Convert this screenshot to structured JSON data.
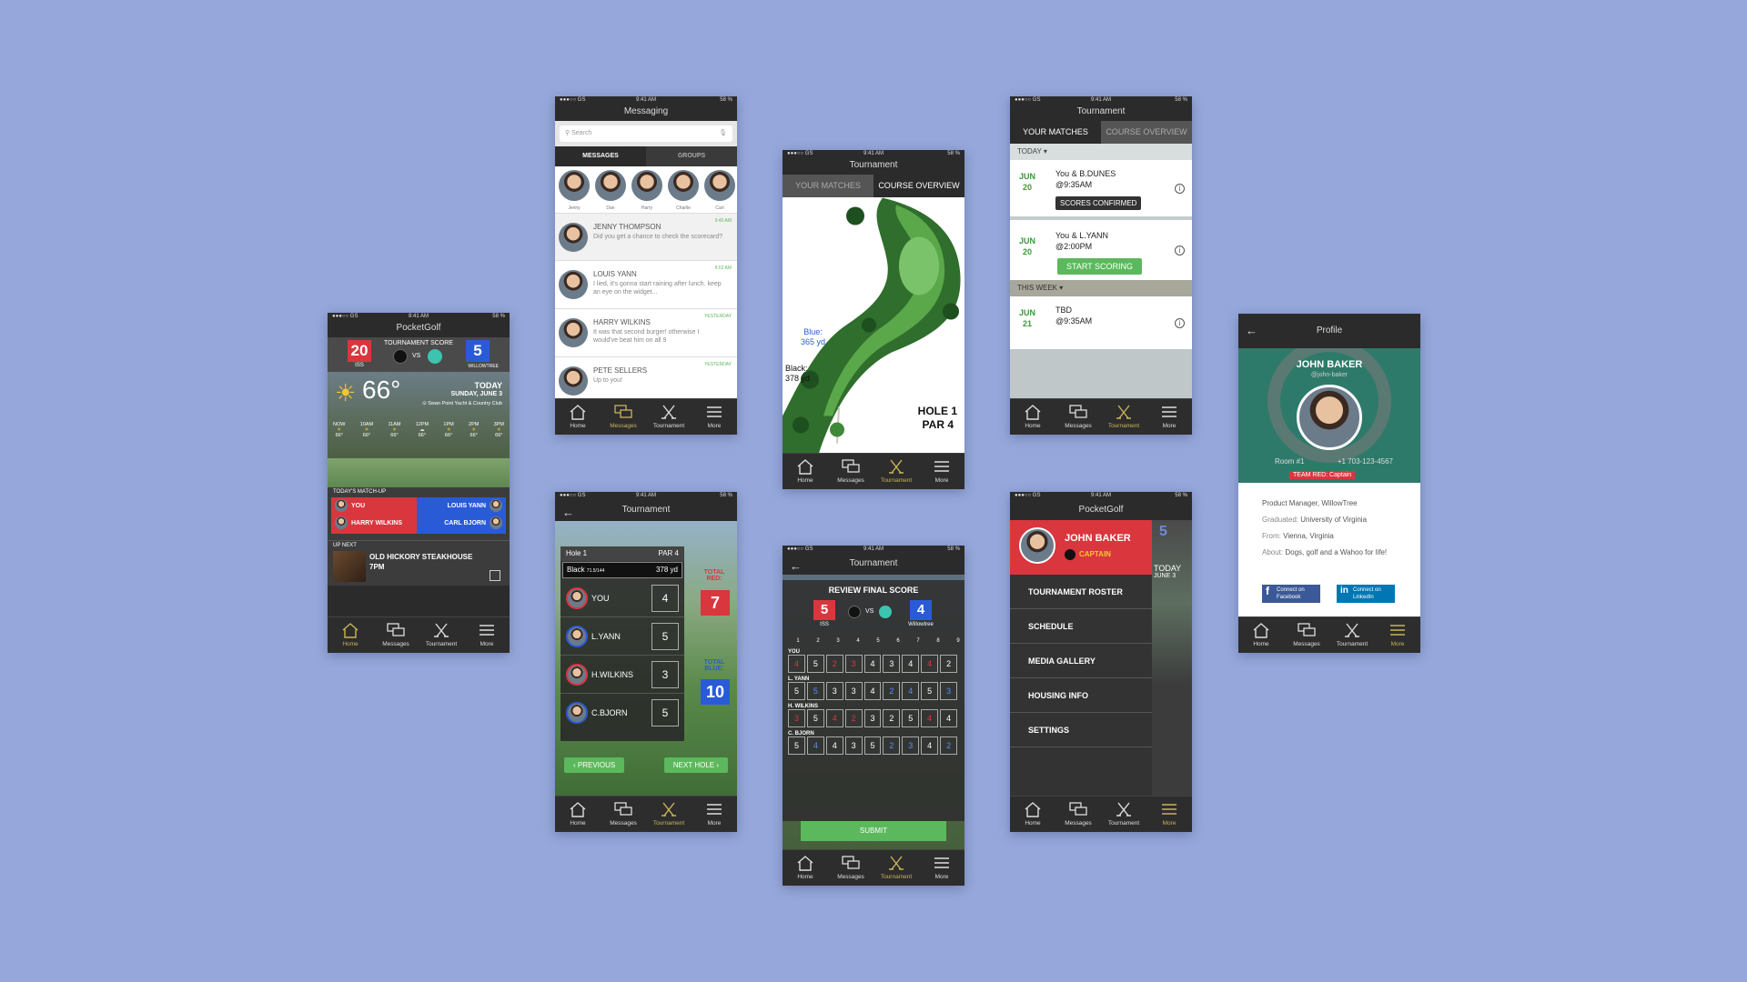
{
  "status": {
    "carrier": "●●●○○ GS",
    "time": "9:41 AM",
    "battery": "58 %"
  },
  "s1time": "8:41 AM",
  "tabs": [
    "Home",
    "Messages",
    "Tournament",
    "More"
  ],
  "colors": {
    "red": "#d9363e",
    "blue": "#2a5bd7",
    "gold": "#c9b458",
    "green": "#5cb85c"
  },
  "home": {
    "title": "PocketGolf",
    "tournament_label": "TOURNAMENT SCORE",
    "vs": "VS",
    "red_score": "20",
    "red_team": "ISS",
    "blue_score": "5",
    "blue_team": "WILLOWTREE",
    "temp": "66°",
    "today": "TODAY",
    "date": "SUNDAY, JUNE 3",
    "location": "Swan Point Yacht & Country Club",
    "forecast": [
      {
        "t": "NOW",
        "v": "66°"
      },
      {
        "t": "10AM",
        "v": "66°"
      },
      {
        "t": "11AM",
        "v": "66°"
      },
      {
        "t": "12PM",
        "v": "66°"
      },
      {
        "t": "1PM",
        "v": "66°"
      },
      {
        "t": "2PM",
        "v": "66°"
      },
      {
        "t": "3PM",
        "v": "66°"
      }
    ],
    "matchup_label": "TODAY'S MATCH-UP",
    "you": "YOU",
    "p2": "HARRY WILKINS",
    "p3": "LOUIS YANN",
    "p4": "CARL BJORN",
    "upnext_label": "UP NEXT",
    "event": "OLD HICKORY STEAKHOUSE",
    "event_time": "7PM"
  },
  "messaging": {
    "title": "Messaging",
    "search": "Search",
    "tab1": "MESSAGES",
    "tab2": "GROUPS",
    "contacts": [
      "Jenny",
      "Dan",
      "Harry",
      "Charlie",
      "Carl"
    ],
    "threads": [
      {
        "name": "JENNY THOMPSON",
        "time": "9:40 AM",
        "text": "Did you get a chance to check the scorecard?"
      },
      {
        "name": "LOUIS YANN",
        "time": "9:02 AM",
        "text": "I lied, it's gonna start raining after lunch. keep an eye on the widget..."
      },
      {
        "name": "HARRY WILKINS",
        "time": "YESTERDAY",
        "text": "It was that second burger! otherwise I would've beat him on all 9"
      },
      {
        "name": "PETE SELLERS",
        "time": "YESTERDAY",
        "text": "Up to you!"
      }
    ]
  },
  "course": {
    "title": "Tournament",
    "tab1": "YOUR MATCHES",
    "tab2": "COURSE OVERVIEW",
    "blue_label": "Blue:",
    "blue_yd": "365 yd",
    "black_label": "Black:",
    "black_yd": "378 yd",
    "hole": "HOLE 1",
    "par": "PAR 4"
  },
  "matches": {
    "title": "Tournament",
    "tab1": "YOUR MATCHES",
    "tab2": "COURSE OVERVIEW",
    "today": "TODAY",
    "thisweek": "THIS WEEK",
    "items": [
      {
        "mon": "JUN",
        "day": "20",
        "line1": "You & B.DUNES",
        "line2": "@9:35AM",
        "btn": "SCORES CONFIRMED"
      },
      {
        "mon": "JUN",
        "day": "20",
        "line1": "You & L.YANN",
        "line2": "@2:00PM",
        "btn": "START SCORING"
      },
      {
        "mon": "JUN",
        "day": "21",
        "line1": "TBD",
        "line2": "@9:35AM",
        "btn": ""
      }
    ]
  },
  "scoring": {
    "title": "Tournament",
    "hole": "Hole 1",
    "par": "PAR 4",
    "tee": "Black",
    "tee_rating": "71.5/144",
    "yards": "378 yd",
    "players": [
      {
        "name": "YOU",
        "score": "4"
      },
      {
        "name": "L.YANN",
        "score": "5"
      },
      {
        "name": "H.WILKINS",
        "score": "3"
      },
      {
        "name": "C.BJORN",
        "score": "5"
      }
    ],
    "total_red_label": "TOTAL RED:",
    "total_red": "7",
    "total_blue_label": "TOTAL BLUE:",
    "total_blue": "10",
    "prev": "PREVIOUS",
    "next": "NEXT HOLE"
  },
  "review": {
    "title": "Tournament",
    "heading": "REVIEW FINAL SCORE",
    "red": "5",
    "red_team": "ISS",
    "blue": "4",
    "blue_team": "Willowtree",
    "vs": "VS",
    "holes": [
      "1",
      "2",
      "3",
      "4",
      "5",
      "6",
      "7",
      "8",
      "9"
    ],
    "rows": [
      {
        "name": "YOU",
        "s": [
          "4",
          "5",
          "2",
          "3",
          "4",
          "3",
          "4",
          "4",
          "2"
        ]
      },
      {
        "name": "L. YANN",
        "s": [
          "5",
          "5",
          "3",
          "3",
          "4",
          "2",
          "4",
          "5",
          "3"
        ]
      },
      {
        "name": "H. WILKINS",
        "s": [
          "3",
          "5",
          "4",
          "2",
          "3",
          "2",
          "5",
          "4",
          "4"
        ]
      },
      {
        "name": "C. BJORN",
        "s": [
          "5",
          "4",
          "4",
          "3",
          "5",
          "2",
          "3",
          "4",
          "2"
        ]
      }
    ],
    "submit": "SUBMIT"
  },
  "menu": {
    "title": "PocketGolf",
    "name": "JOHN BAKER",
    "role": "CAPTAIN",
    "items": [
      "TOURNAMENT ROSTER",
      "SCHEDULE",
      "MEDIA GALLERY",
      "HOUSING INFO",
      "SETTINGS"
    ],
    "peek": [
      "5",
      "TODAY",
      "JUNE 3"
    ]
  },
  "profile": {
    "title": "Profile",
    "name": "JOHN BAKER",
    "handle": "@john-baker",
    "room": "Room #1",
    "phone": "+1 703-123-4567",
    "team": "TEAM RED: Captain",
    "job": "Product Manager, WillowTree",
    "grad_label": "Graduated:",
    "grad": "University of Virginia",
    "from_label": "From:",
    "from": "Vienna, Virginia",
    "about_label": "About:",
    "about": "Dogs, golf and a Wahoo for life!",
    "fb": "Connect on Facebook",
    "li": "Connect on LinkedIn"
  }
}
